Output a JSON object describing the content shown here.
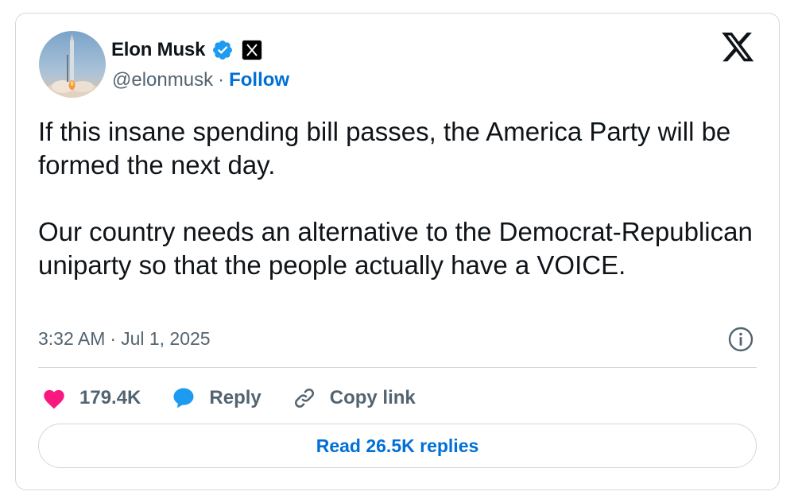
{
  "author": {
    "display_name": "Elon Musk",
    "handle": "@elonmusk",
    "separator": "·",
    "follow_label": "Follow"
  },
  "tweet": {
    "text": "If this insane spending bill passes, the America Party will be formed the next day.\n\nOur country needs an alternative to the Democrat-Republican uniparty so that the people actually have a VOICE.",
    "time": "3:32 AM",
    "date_separator": "·",
    "date": "Jul 1, 2025"
  },
  "actions": {
    "like_count": "179.4K",
    "reply_label": "Reply",
    "copy_link_label": "Copy link"
  },
  "read_replies_label": "Read 26.5K replies",
  "colors": {
    "link_blue": "#006fd6",
    "like_red": "#f91880",
    "reply_blue": "#1d9bf0",
    "secondary_text": "#536471",
    "border": "#cfd9de"
  },
  "icons": [
    "verified-badge-icon",
    "x-affiliation-icon",
    "x-logo-icon",
    "info-icon",
    "heart-icon",
    "reply-bubble-icon",
    "link-icon"
  ]
}
